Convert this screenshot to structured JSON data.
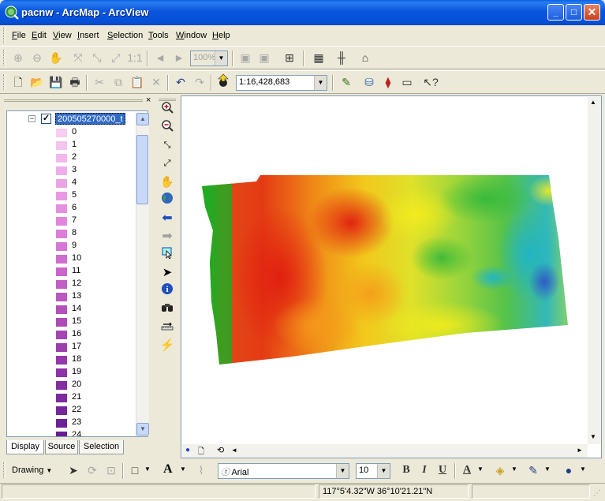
{
  "window": {
    "title": "pacnw - ArcMap - ArcView",
    "minimize_glyph": "_",
    "maximize_glyph": "□",
    "close_glyph": "✕"
  },
  "menu": [
    {
      "underline": "F",
      "rest": "ile"
    },
    {
      "underline": "E",
      "rest": "dit"
    },
    {
      "underline": "V",
      "rest": "iew"
    },
    {
      "underline": "I",
      "rest": "nsert"
    },
    {
      "underline": "S",
      "rest": "election"
    },
    {
      "underline": "T",
      "rest": "ools"
    },
    {
      "underline": "W",
      "rest": "indow"
    },
    {
      "underline": "H",
      "rest": "elp"
    }
  ],
  "layout_toolbar": {
    "zoom_percent": "100%"
  },
  "standard_toolbar": {
    "map_scale": "1:16,428,683"
  },
  "toc": {
    "layer_name": "200505270000_t",
    "layer_checked": true,
    "classes": [
      {
        "label": "0",
        "color": "#f6cdf0"
      },
      {
        "label": "1",
        "color": "#f4c3ee"
      },
      {
        "label": "2",
        "color": "#f2b8ec"
      },
      {
        "label": "3",
        "color": "#efaee9"
      },
      {
        "label": "4",
        "color": "#eca3e6"
      },
      {
        "label": "5",
        "color": "#e999e3"
      },
      {
        "label": "6",
        "color": "#e58fe0"
      },
      {
        "label": "7",
        "color": "#e087dc"
      },
      {
        "label": "8",
        "color": "#db7fd8"
      },
      {
        "label": "9",
        "color": "#d577d4"
      },
      {
        "label": "10",
        "color": "#cf6ecf"
      },
      {
        "label": "11",
        "color": "#c966ca"
      },
      {
        "label": "12",
        "color": "#c25ec5"
      },
      {
        "label": "13",
        "color": "#bb57c0"
      },
      {
        "label": "14",
        "color": "#b450bb"
      },
      {
        "label": "15",
        "color": "#ad4ab7"
      },
      {
        "label": "16",
        "color": "#a544b3"
      },
      {
        "label": "17",
        "color": "#9d3eaf"
      },
      {
        "label": "18",
        "color": "#9538ab"
      },
      {
        "label": "19",
        "color": "#8d33a7"
      },
      {
        "label": "20",
        "color": "#852ea3"
      },
      {
        "label": "21",
        "color": "#7d299f"
      },
      {
        "label": "22",
        "color": "#75259b"
      },
      {
        "label": "23",
        "color": "#6d2197"
      },
      {
        "label": "24",
        "color": "#661d93"
      }
    ],
    "tabs": [
      "Display",
      "Source",
      "Selection"
    ]
  },
  "drawing_toolbar": {
    "drawing_label": "Drawing",
    "font_name": "Arial",
    "font_size": "10",
    "bold": "B",
    "italic": "I",
    "underline": "U",
    "text_tool": "A"
  },
  "status": {
    "coordinates": "117°5'4.32\"W  36°10'21.21\"N"
  },
  "colors": {
    "titlebar": "#0855dd",
    "chrome": "#ece9d8",
    "selection": "#316ac5"
  }
}
